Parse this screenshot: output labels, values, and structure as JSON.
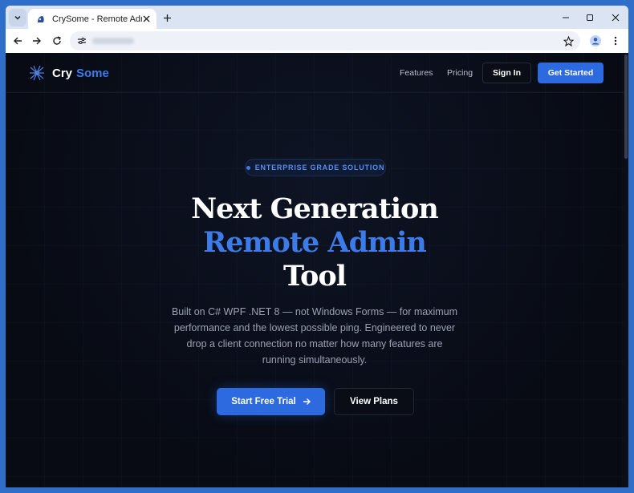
{
  "browser": {
    "tab_title": "CrySome - Remote Admin Tool"
  },
  "nav": {
    "logo_part1": "Cry",
    "logo_part2": "Some",
    "links": [
      "Features",
      "Pricing"
    ],
    "sign_in": "Sign In",
    "get_started": "Get Started"
  },
  "hero": {
    "badge": "ENTERPRISE GRADE SOLUTION",
    "title_line1": "Next Generation",
    "title_line2": "Remote Admin",
    "title_line3": "Tool",
    "description": "Built on C# WPF .NET 8 — not Windows Forms — for maximum performance and the lowest possible ping. Engineered to never drop a client connection no matter how many features are running simultaneously.",
    "cta_primary": "Start Free Trial",
    "cta_secondary": "View Plans"
  },
  "colors": {
    "accent": "#2d6ae0",
    "accent_text": "#3d7be8",
    "page_bg": "#080b14",
    "desktop_bg": "#2f6fc9"
  }
}
